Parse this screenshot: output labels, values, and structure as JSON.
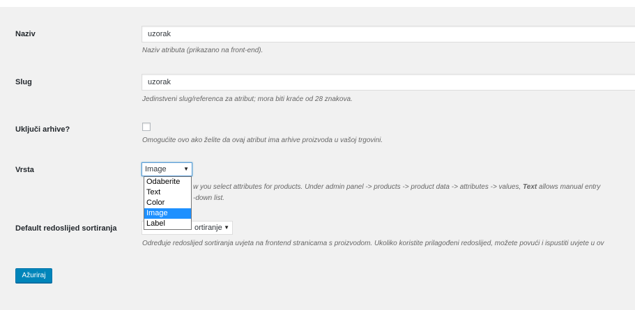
{
  "fields": {
    "name": {
      "label": "Naziv",
      "value": "uzorak",
      "description": "Naziv atributa (prikazano na front-end)."
    },
    "slug": {
      "label": "Slug",
      "value": "uzorak",
      "description": "Jedinstveni slug/referenca za atribut; mora biti kraće od 28 znakova."
    },
    "archives": {
      "label": "Uključi arhive?",
      "checked": false,
      "description": "Omogućite ovo ako želite da ovaj atribut ima arhive proizvoda u vašoj trgovini."
    },
    "type": {
      "label": "Vrsta",
      "selected": "Image",
      "arrow_icon": "dropdown-arrow-icon",
      "options": [
        "Odaberite",
        "Text",
        "Color",
        "Image",
        "Label"
      ],
      "description_line1_pre": "w you select attributes for products. Under admin panel -> products -> product data -> attributes -> values, ",
      "description_line1_bold": "Text",
      "description_line1_post": " allows manual entry",
      "description_line2": "-down list."
    },
    "sort_order": {
      "label": "Default redoslijed sortiranja",
      "selected_visible": "ortiranje",
      "description": "Određuje redoslijed sortiranja uvjeta na frontend stranicama s proizvodom. Ukoliko koristite prilagođeni redoslijed, možete povući i ispustiti uvjete u ov"
    }
  },
  "submit": {
    "label": "Ažuriraj"
  },
  "colors": {
    "background": "#f1f1f1",
    "primary_button": "#0085ba",
    "selected_option": "#1e90ff"
  }
}
